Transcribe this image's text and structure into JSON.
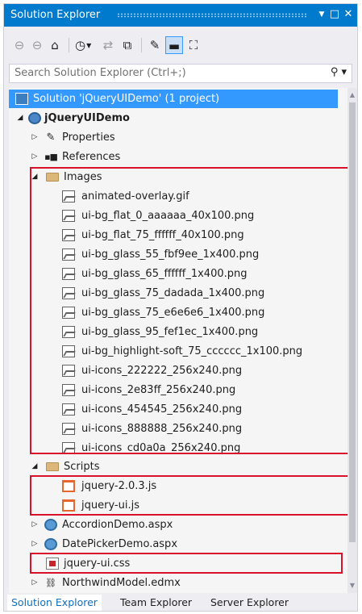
{
  "window": {
    "title": "Solution Explorer",
    "buttons": {
      "dropdown": "▼",
      "maximize": "□",
      "close": "✕"
    }
  },
  "toolbar": {
    "back_icon": "back-icon",
    "forward_icon": "forward-icon",
    "home_icon": "home-icon",
    "pending_changes_icon": "clock-icon",
    "sync_icon": "sync-icon",
    "collapse_icon": "collapse-all-icon",
    "properties_icon": "wrench-icon",
    "show_all_files_icon": "show-all-files-icon",
    "view_class_diagram_icon": "class-diagram-icon"
  },
  "search": {
    "placeholder": "Search Solution Explorer (Ctrl+;)",
    "value": ""
  },
  "tree": {
    "solution": {
      "label": "Solution 'jQueryUIDemo' (1 project)"
    },
    "project": {
      "label": "jQueryUIDemo"
    },
    "properties": {
      "label": "Properties"
    },
    "references": {
      "label": "References"
    },
    "images_folder": {
      "label": "Images",
      "files": [
        "animated-overlay.gif",
        "ui-bg_flat_0_aaaaaa_40x100.png",
        "ui-bg_flat_75_ffffff_40x100.png",
        "ui-bg_glass_55_fbf9ee_1x400.png",
        "ui-bg_glass_65_ffffff_1x400.png",
        "ui-bg_glass_75_dadada_1x400.png",
        "ui-bg_glass_75_e6e6e6_1x400.png",
        "ui-bg_glass_95_fef1ec_1x400.png",
        "ui-bg_highlight-soft_75_cccccc_1x100.png",
        "ui-icons_222222_256x240.png",
        "ui-icons_2e83ff_256x240.png",
        "ui-icons_454545_256x240.png",
        "ui-icons_888888_256x240.png",
        "ui-icons_cd0a0a_256x240.png"
      ]
    },
    "scripts_folder": {
      "label": "Scripts",
      "files": [
        "jquery-2.0.3.js",
        "jquery-ui.js"
      ]
    },
    "accordion": {
      "label": "AccordionDemo.aspx"
    },
    "datepicker": {
      "label": "DatePickerDemo.aspx"
    },
    "css_file": {
      "label": "jquery-ui.css"
    },
    "edmx": {
      "label": "NorthwindModel.edmx"
    }
  },
  "tabs": [
    "Solution Explorer",
    "Team Explorer",
    "Server Explorer"
  ],
  "colors": {
    "accent": "#007acc",
    "selection": "#3399ff",
    "highlight_box": "#d9112a"
  }
}
